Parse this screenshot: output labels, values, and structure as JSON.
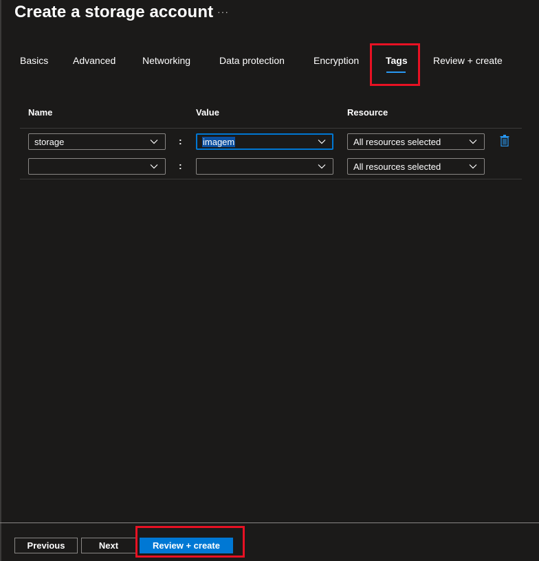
{
  "header": {
    "title": "Create a storage account",
    "more_label": "···"
  },
  "tabs": [
    {
      "label": "Basics",
      "active": false
    },
    {
      "label": "Advanced",
      "active": false
    },
    {
      "label": "Networking",
      "active": false
    },
    {
      "label": "Data protection",
      "active": false
    },
    {
      "label": "Encryption",
      "active": false
    },
    {
      "label": "Tags",
      "active": true
    },
    {
      "label": "Review + create",
      "active": false
    }
  ],
  "table": {
    "headers": {
      "name": "Name",
      "value": "Value",
      "resource": "Resource"
    },
    "separator": ":",
    "rows": [
      {
        "name": "storage",
        "value": "imagem",
        "resource": "All resources selected"
      },
      {
        "name": "",
        "value": "",
        "resource": "All resources selected"
      }
    ]
  },
  "icons": {
    "more": "more-ellipsis-icon",
    "chevron": "chevron-down-icon",
    "delete": "trash-icon"
  },
  "footer": {
    "previous_label": "Previous",
    "next_label": "Next",
    "review_create_label": "Review + create"
  },
  "colors": {
    "background": "#1b1a19",
    "accent": "#0078d4",
    "highlight": "#e81123",
    "text": "#ffffff"
  }
}
